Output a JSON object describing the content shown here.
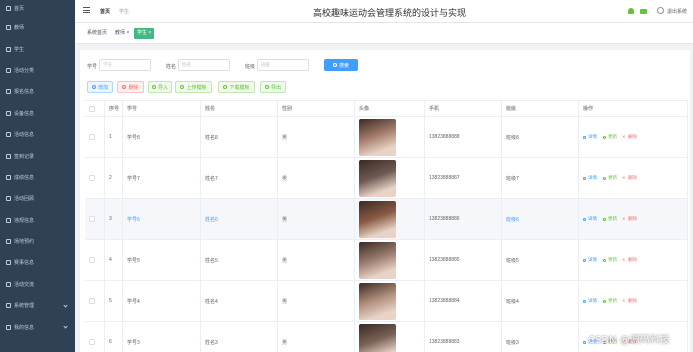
{
  "sidebar": {
    "items": [
      {
        "label": "首页",
        "chevron": false
      },
      {
        "label": "教师",
        "chevron": false
      },
      {
        "label": "学生",
        "chevron": false
      },
      {
        "label": "活动分类",
        "chevron": false
      },
      {
        "label": "报名信息",
        "chevron": false
      },
      {
        "label": "设备信息",
        "chevron": false
      },
      {
        "label": "活动信息",
        "chevron": false
      },
      {
        "label": "签到记录",
        "chevron": false
      },
      {
        "label": "成绩信息",
        "chevron": false
      },
      {
        "label": "活动回顾",
        "chevron": false
      },
      {
        "label": "违规信息",
        "chevron": false
      },
      {
        "label": "场地预约",
        "chevron": false
      },
      {
        "label": "赛事信息",
        "chevron": false
      },
      {
        "label": "活动交流",
        "chevron": false
      },
      {
        "label": "系统管理",
        "chevron": true
      },
      {
        "label": "我的信息",
        "chevron": true
      }
    ]
  },
  "header": {
    "breadcrumb_home": "首页",
    "breadcrumb_current": "学生",
    "title": "高校趣味运动会管理系统的设计与实现",
    "logout": "退出系统"
  },
  "tags": [
    {
      "label": "系统首页",
      "active": false
    },
    {
      "label": "教师 ×",
      "active": false
    },
    {
      "label": "学生 ×",
      "active": true
    }
  ],
  "search": {
    "fields": [
      {
        "label": "学号",
        "placeholder": "学号"
      },
      {
        "label": "姓名",
        "placeholder": "姓名"
      },
      {
        "label": "班级",
        "placeholder": "班级"
      }
    ],
    "button": "搜索"
  },
  "toolbar": {
    "add": "增加",
    "delete": "删除",
    "import": "导入",
    "upload": "上传模板",
    "download": "下载模板",
    "export": "导出"
  },
  "table": {
    "headers": [
      "序号",
      "学号",
      "姓名",
      "性别",
      "头像",
      "手机",
      "班级",
      "操作"
    ],
    "rows": [
      {
        "index": "1",
        "xuehao": "学号8",
        "name": "姓名8",
        "gender": "男",
        "phone": "13823888888",
        "banji": "班级8",
        "img": "#a47d6a"
      },
      {
        "index": "2",
        "xuehao": "学号7",
        "name": "姓名7",
        "gender": "男",
        "phone": "13823888887",
        "banji": "班级7",
        "img": "#6e5a52"
      },
      {
        "index": "3",
        "xuehao": "学号6",
        "name": "姓名6",
        "gender": "男",
        "phone": "13823888886",
        "banji": "班级6",
        "img": "#8a5a43"
      },
      {
        "index": "4",
        "xuehao": "学号5",
        "name": "姓名5",
        "gender": "男",
        "phone": "13823888885",
        "banji": "班级5",
        "img": "#9a7b6f"
      },
      {
        "index": "5",
        "xuehao": "学号4",
        "name": "姓名4",
        "gender": "男",
        "phone": "13823888884",
        "banji": "班级4",
        "img": "#b08e7c"
      },
      {
        "index": "6",
        "xuehao": "学号3",
        "name": "姓名3",
        "gender": "男",
        "phone": "13823888883",
        "banji": "班级3",
        "img": "#7a6258"
      }
    ],
    "actions": {
      "detail": "详情",
      "edit": "更新",
      "delete": "删除"
    }
  },
  "watermark": "CSDN @源码科技",
  "colors": {
    "sidebar": "#304156",
    "primary": "#409eff",
    "success": "#67c23a",
    "danger": "#f56c6c",
    "tag_active": "#42b983"
  }
}
